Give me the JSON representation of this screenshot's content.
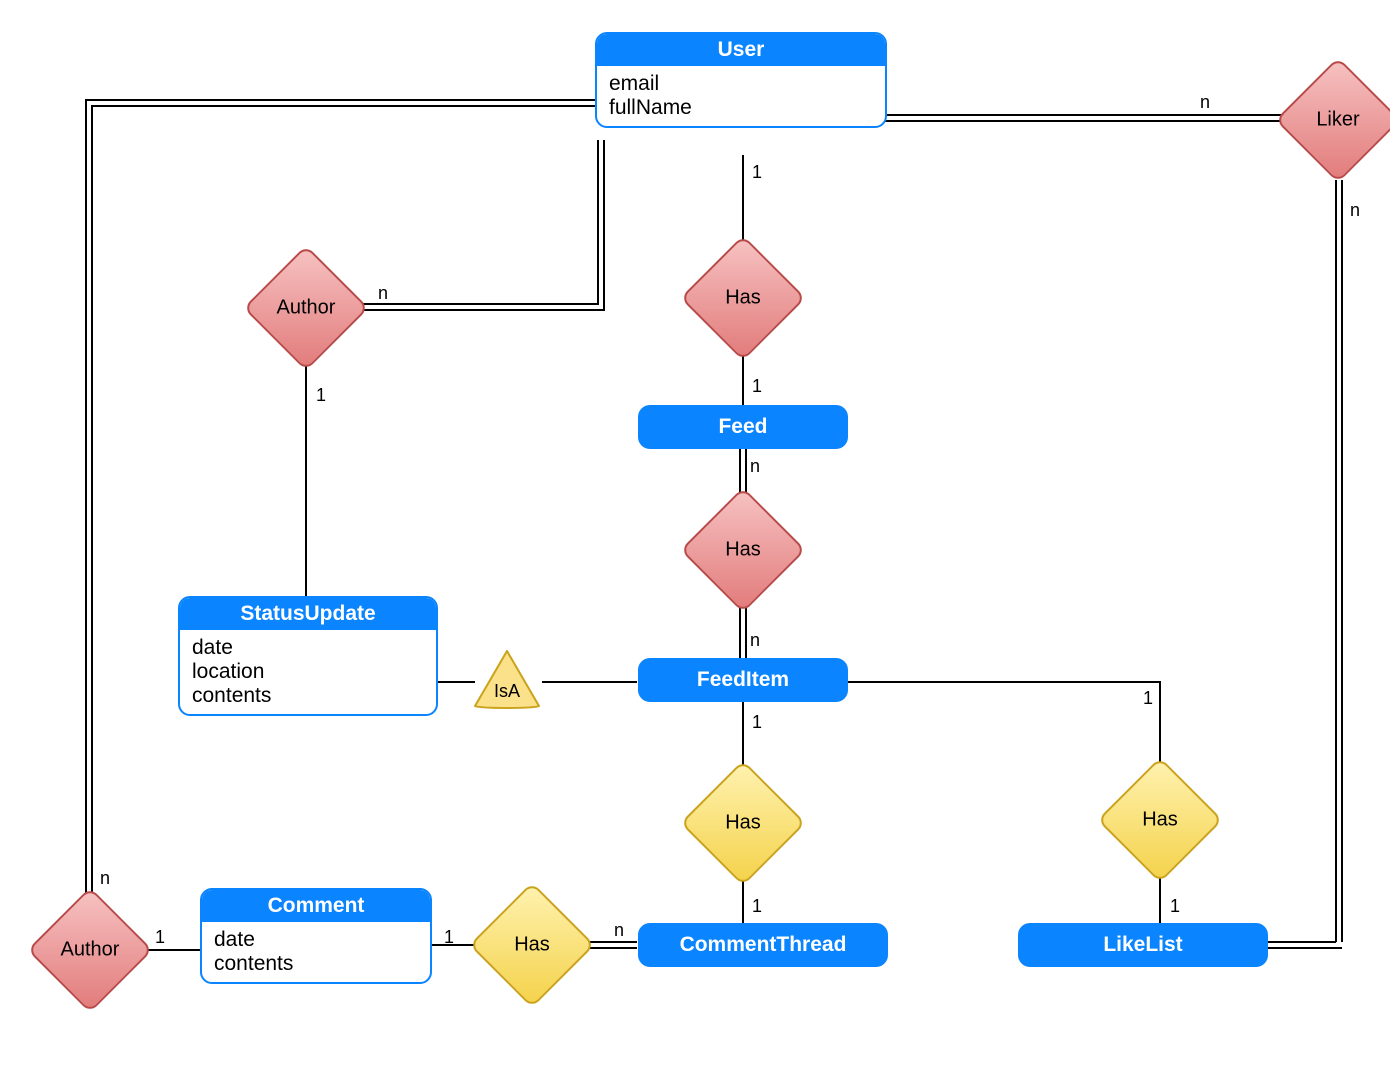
{
  "entities": {
    "user": {
      "title": "User",
      "attrs": [
        "email",
        "fullName"
      ]
    },
    "statusUpdate": {
      "title": "StatusUpdate",
      "attrs": [
        "date",
        "location",
        "contents"
      ]
    },
    "comment": {
      "title": "Comment",
      "attrs": [
        "date",
        "contents"
      ]
    }
  },
  "pills": {
    "feed": "Feed",
    "feedItem": "FeedItem",
    "commentThread": "CommentThread",
    "likeList": "LikeList"
  },
  "rel": {
    "author1": "Author",
    "author2": "Author",
    "liker": "Liker",
    "has_user_feed": "Has",
    "has_feed_item": "Has",
    "has_item_thread": "Has",
    "has_item_like": "Has",
    "has_thread_comment": "Has",
    "isA": "IsA"
  },
  "card": {
    "one": "1",
    "many": "n"
  }
}
